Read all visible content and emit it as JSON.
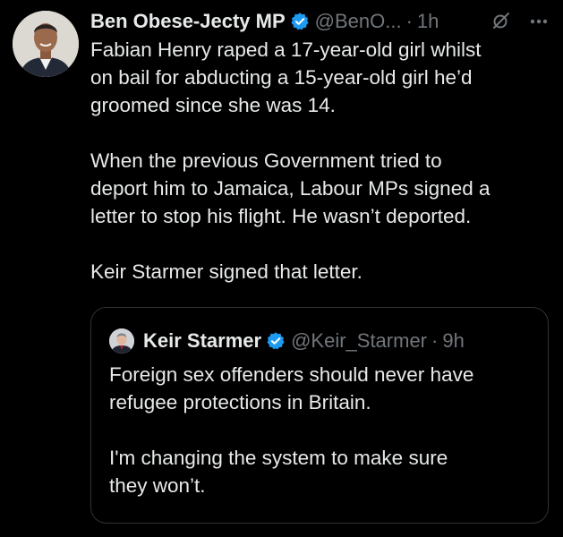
{
  "tweet": {
    "author_name": "Ben Obese-Jecty MP",
    "handle": "@BenO...",
    "separator": "·",
    "time": "1h",
    "paragraphs": [
      "Fabian Henry raped a 17-year-old girl whilst\non bail for abducting a 15-year-old girl he’d\ngroomed since she was 14.",
      "When the previous Government tried to\ndeport him to Jamaica, Labour MPs signed a\nletter to stop his flight. He wasn’t deported.",
      "Keir Starmer signed that letter."
    ],
    "icons": {
      "verified": "verified-badge-icon",
      "grok": "grok-icon",
      "more": "more-options-icon"
    }
  },
  "quoted_tweet": {
    "author_name": "Keir Starmer",
    "handle": "@Keir_Starmer",
    "separator": "·",
    "time": "9h",
    "paragraphs": [
      "Foreign sex offenders should never have\nrefugee protections in Britain.",
      "I'm changing the system to make sure\nthey won’t."
    ]
  },
  "colors": {
    "background": "#000000",
    "text_primary": "#e7e9ea",
    "text_secondary": "#71767b",
    "verified_blue": "#1d9bf0",
    "border": "#2f3336"
  }
}
